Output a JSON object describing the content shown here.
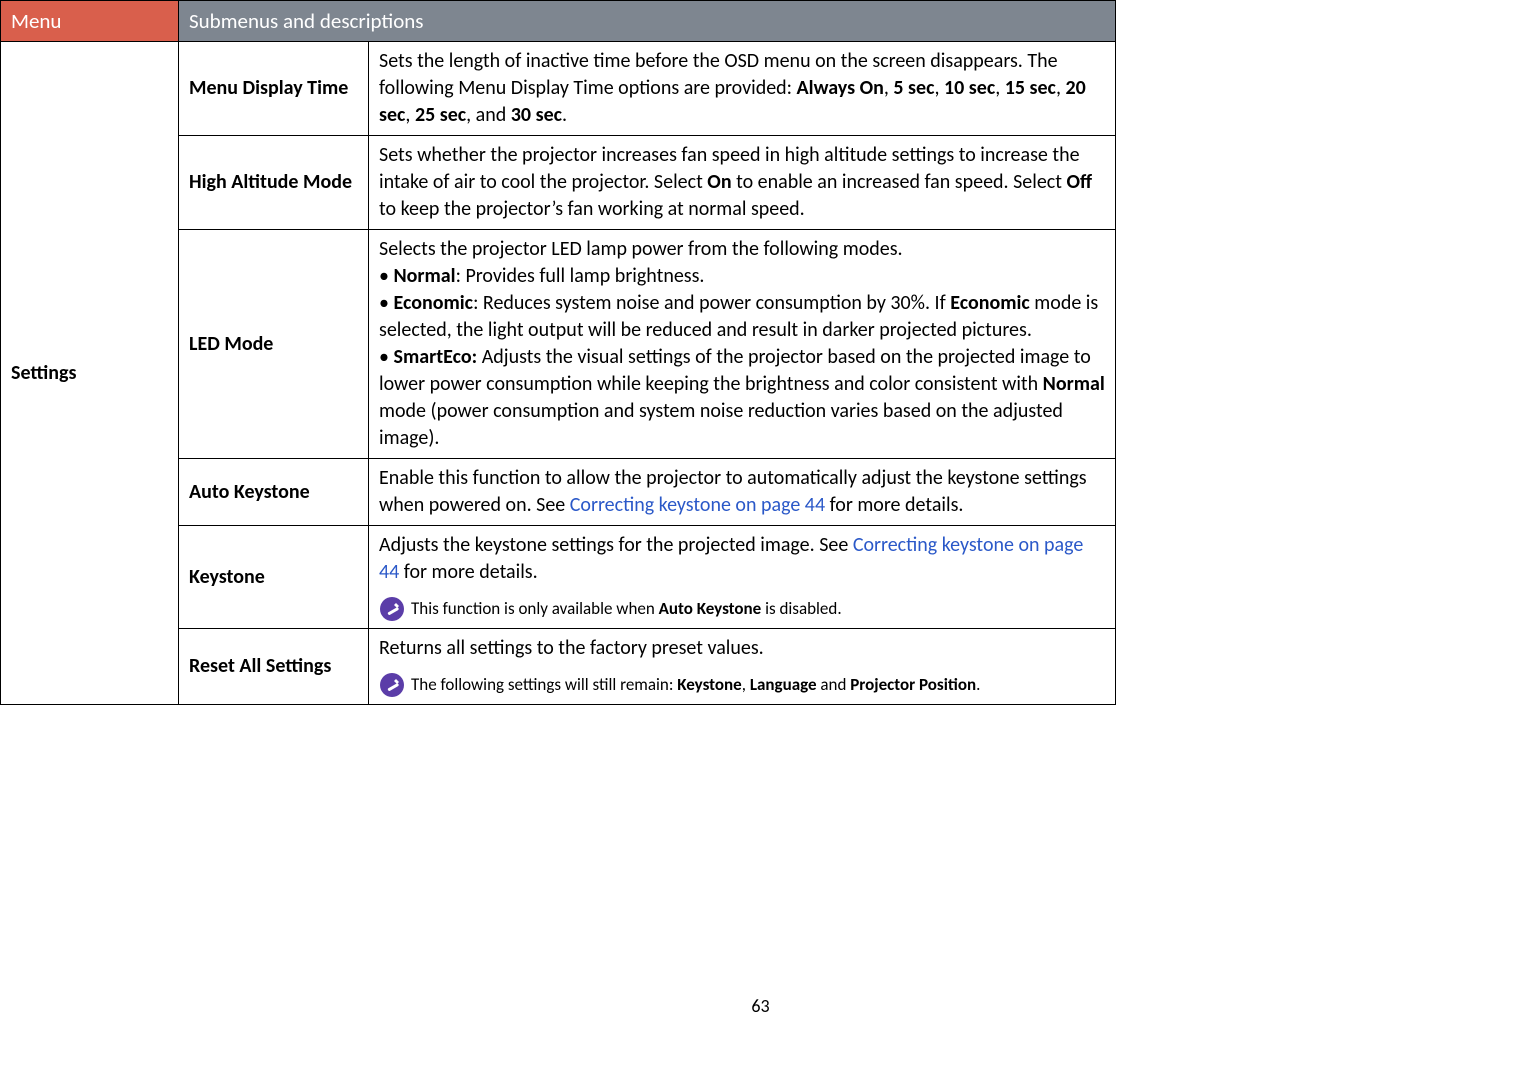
{
  "header": {
    "menu": "Menu",
    "sub": "Submenus and descriptions"
  },
  "category": "Settings",
  "rows": {
    "menu_display_time": {
      "name": "Menu Display Time",
      "desc_pre": "Sets the length of inactive time before the OSD menu on the screen disappears. The following Menu Display Time options are provided: ",
      "opt1": "Always On",
      "c1": ", ",
      "opt2": "5 sec",
      "c2": ", ",
      "opt3": "10 sec",
      "c3": ", ",
      "opt4": "15 sec",
      "c4": ", ",
      "opt5": "20 sec",
      "c5": ", ",
      "opt6": "25 sec",
      "c6": ", and ",
      "opt7": "30 sec",
      "tail": "."
    },
    "high_altitude": {
      "name": "High Altitude Mode",
      "p1": "Sets whether the projector increases fan speed in high altitude settings to increase the intake of air to cool the projector. Select ",
      "b1": "On",
      "p2": " to enable an increased fan speed. Select ",
      "b2": "Off",
      "p3": " to keep the projector’s fan working at normal speed."
    },
    "led_mode": {
      "name": "LED Mode",
      "intro": "Selects the projector LED lamp power from the following modes.",
      "bullet1_pre": "• ",
      "bullet1_b": "Normal",
      "bullet1_post": ": Provides full lamp brightness.",
      "bullet2_pre": "• ",
      "bullet2_b": "Economic",
      "bullet2_mid": ": Reduces system noise and power consumption by 30%. If ",
      "bullet2_b2": "Economic",
      "bullet2_post": " mode is selected, the light output will be reduced and result in darker projected pictures.",
      "bullet3_pre": "• ",
      "bullet3_b": "SmartEco:",
      "bullet3_mid": " Adjusts the visual settings of the projector based on the projected image to lower power consumption while keeping the brightness and color consistent with ",
      "bullet3_b2": "Normal",
      "bullet3_post": " mode (power consumption and system noise reduction varies based on the adjusted image)."
    },
    "auto_keystone": {
      "name": "Auto Keystone",
      "p1": "Enable this function to allow the projector to automatically adjust the keystone settings when powered on. See ",
      "link": "Correcting keystone on page 44",
      "p2": " for more details."
    },
    "keystone": {
      "name": "Keystone",
      "p1": "Adjusts the keystone settings for the projected image. See ",
      "link": "Correcting keystone on page 44",
      "p2": " for more details.",
      "note_pre": "This function is only available when ",
      "note_b": "Auto Keystone",
      "note_post": " is disabled."
    },
    "reset_all": {
      "name": "Reset All Settings",
      "p1": "Returns all settings to the factory preset values.",
      "note_pre": "The following settings will still remain: ",
      "note_b1": "Keystone",
      "note_c1": ", ",
      "note_b2": "Language",
      "note_c2": " and ",
      "note_b3": "Projector Position",
      "note_tail": "."
    }
  },
  "page_number": "63"
}
